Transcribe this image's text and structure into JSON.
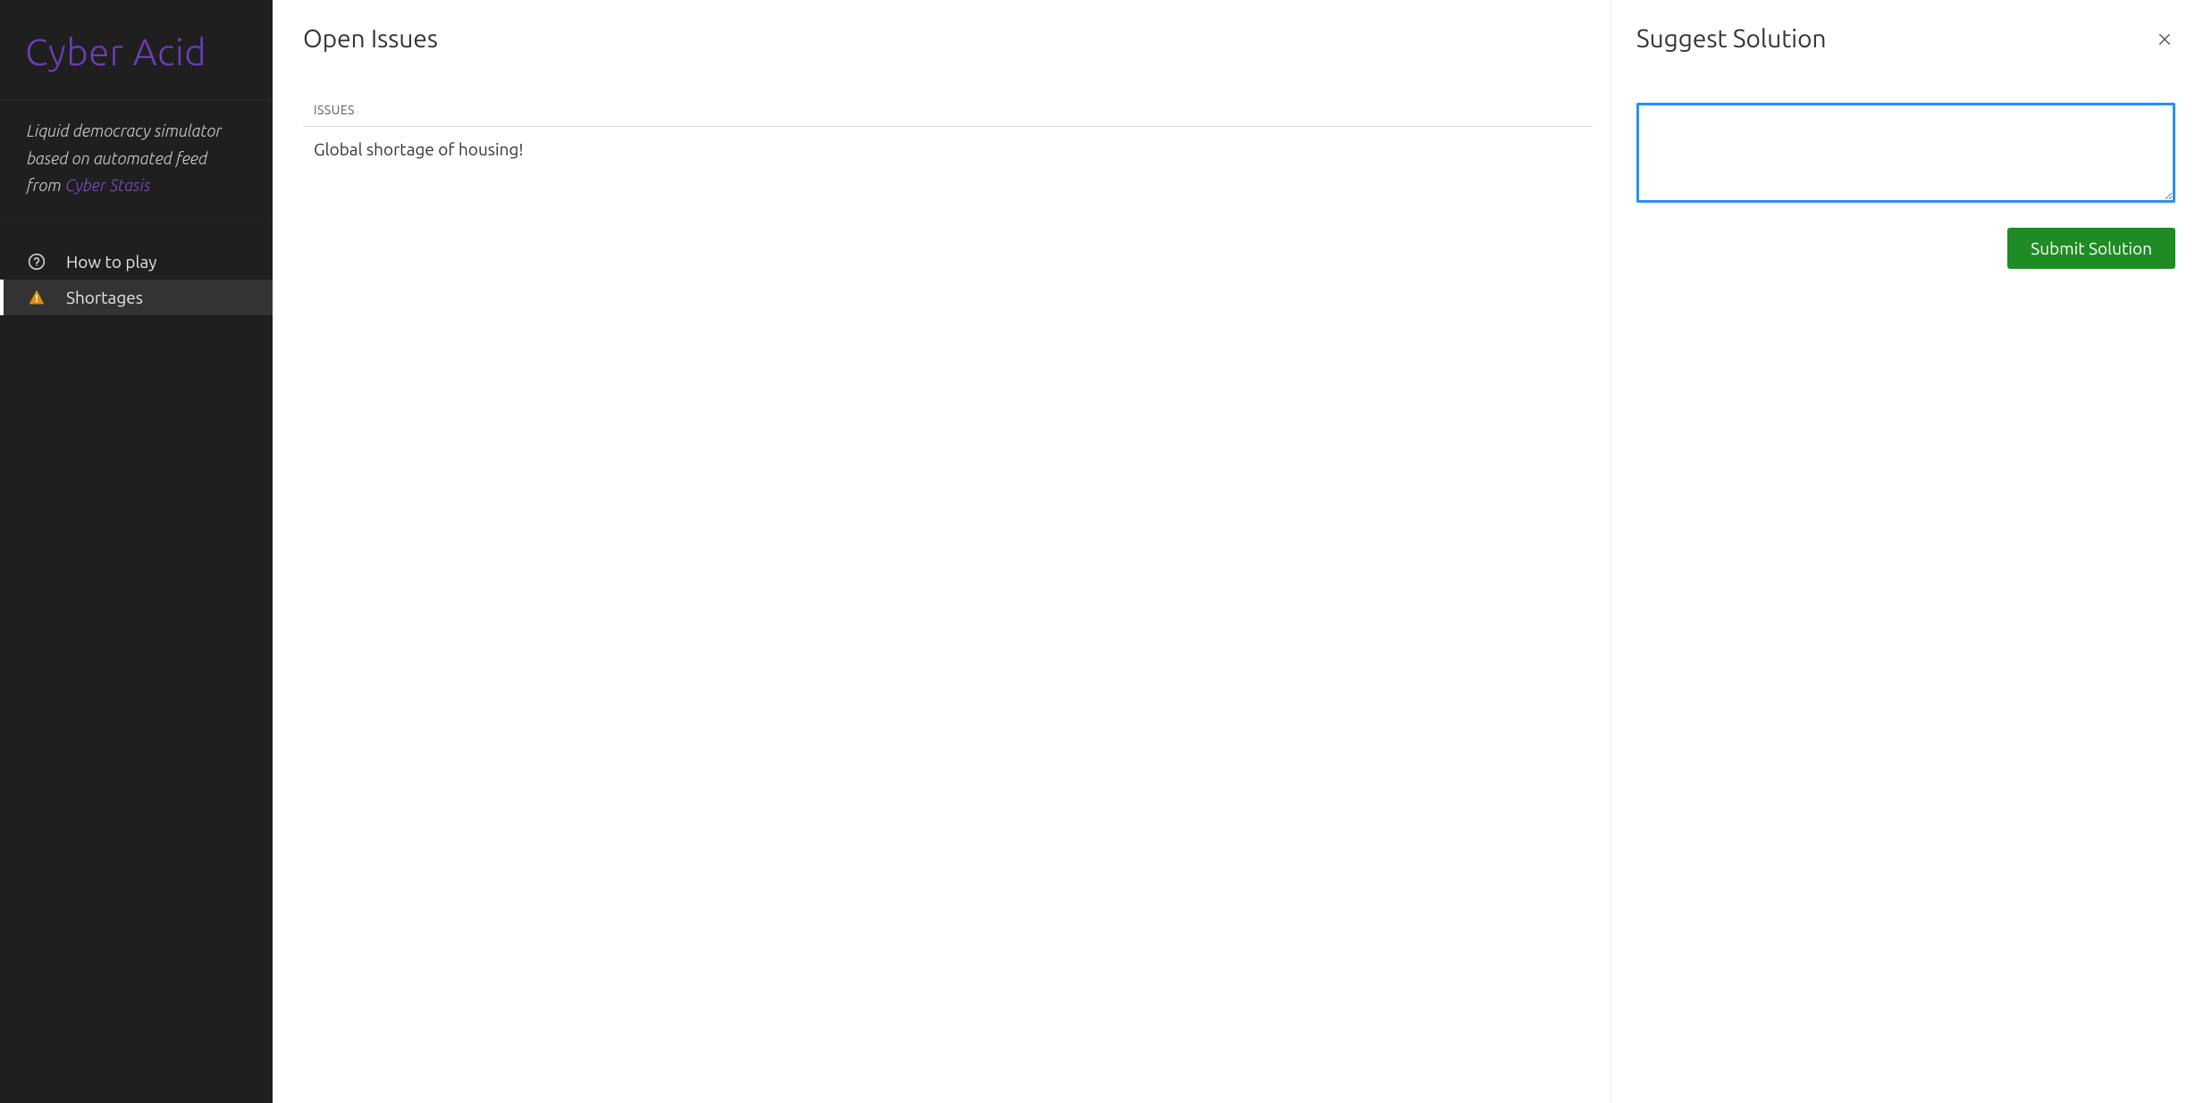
{
  "sidebar": {
    "brand": "Cyber Acid",
    "tagline_prefix": "Liquid democracy simulator based on automated feed from ",
    "tagline_link_text": "Cyber Stasis",
    "nav": {
      "how_to_play": {
        "label": "How to play",
        "icon": "help-circle-icon",
        "active": false
      },
      "shortages": {
        "label": "Shortages",
        "icon": "warning-icon",
        "active": true
      }
    }
  },
  "issues_pane": {
    "title": "Open Issues",
    "column_header": "ISSUES",
    "rows": [
      {
        "text": "Global shortage of housing!"
      }
    ]
  },
  "solution_pane": {
    "title": "Suggest Solution",
    "textarea_value": "",
    "textarea_placeholder": "",
    "submit_label": "Submit Solution"
  }
}
